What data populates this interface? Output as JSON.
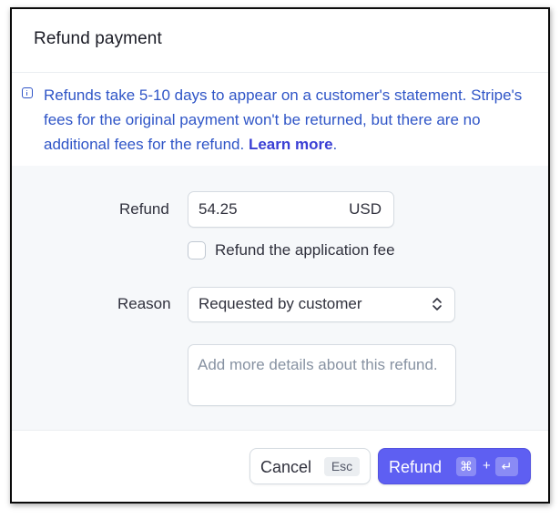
{
  "dialog": {
    "title": "Refund payment"
  },
  "notice": {
    "icon": "info-icon",
    "text": "Refunds take 5-10 days to appear on a customer's statement. Stripe's fees for the original payment won't be returned, but there are no additional fees for the refund. ",
    "link_label": "Learn more",
    "trailing": "."
  },
  "form": {
    "refund_label": "Refund",
    "amount_value": "54.25",
    "currency": "USD",
    "application_fee_label": "Refund the application fee",
    "application_fee_checked": false,
    "reason_label": "Reason",
    "reason_value": "Requested by customer",
    "details_placeholder": "Add more details about this refund."
  },
  "footer": {
    "cancel_label": "Cancel",
    "cancel_shortcut": "Esc",
    "refund_label": "Refund",
    "refund_shortcut_mod": "⌘",
    "refund_shortcut_plus": "+",
    "refund_shortcut_key": "↵"
  },
  "colors": {
    "accent": "#5e5ff2",
    "notice_text": "#2f55c7",
    "form_background": "#f6f8fa"
  }
}
